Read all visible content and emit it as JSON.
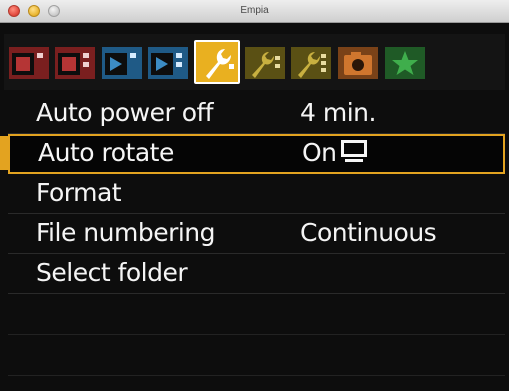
{
  "window": {
    "title": "Empia"
  },
  "tabs": [
    {
      "icon": "camera-shooting-1-icon",
      "color": "#9b2a2a",
      "selected": false
    },
    {
      "icon": "camera-shooting-2-icon",
      "color": "#9b2a2a",
      "selected": false
    },
    {
      "icon": "playback-1-icon",
      "color": "#2a6fa0",
      "selected": false
    },
    {
      "icon": "playback-2-icon",
      "color": "#2a6fa0",
      "selected": false
    },
    {
      "icon": "wrench-setup-1-icon",
      "color": "#e9b020",
      "selected": true
    },
    {
      "icon": "wrench-setup-2-icon",
      "color": "#8a7a1c",
      "selected": false
    },
    {
      "icon": "wrench-setup-3-icon",
      "color": "#8a7a1c",
      "selected": false
    },
    {
      "icon": "custom-camera-icon",
      "color": "#b0602a",
      "selected": false
    },
    {
      "icon": "star-my-menu-icon",
      "color": "#2a8a3a",
      "selected": false
    }
  ],
  "menu": {
    "items": [
      {
        "label": "Auto power off",
        "value": "4 min."
      },
      {
        "label": "Auto rotate",
        "value": "On"
      },
      {
        "label": "Format",
        "value": ""
      },
      {
        "label": "File numbering",
        "value": "Continuous"
      },
      {
        "label": "Select folder",
        "value": ""
      }
    ],
    "selected_index": 1
  },
  "colors": {
    "accent": "#e3a320",
    "background": "#0d0d0d",
    "text": "#f5f5f5"
  }
}
